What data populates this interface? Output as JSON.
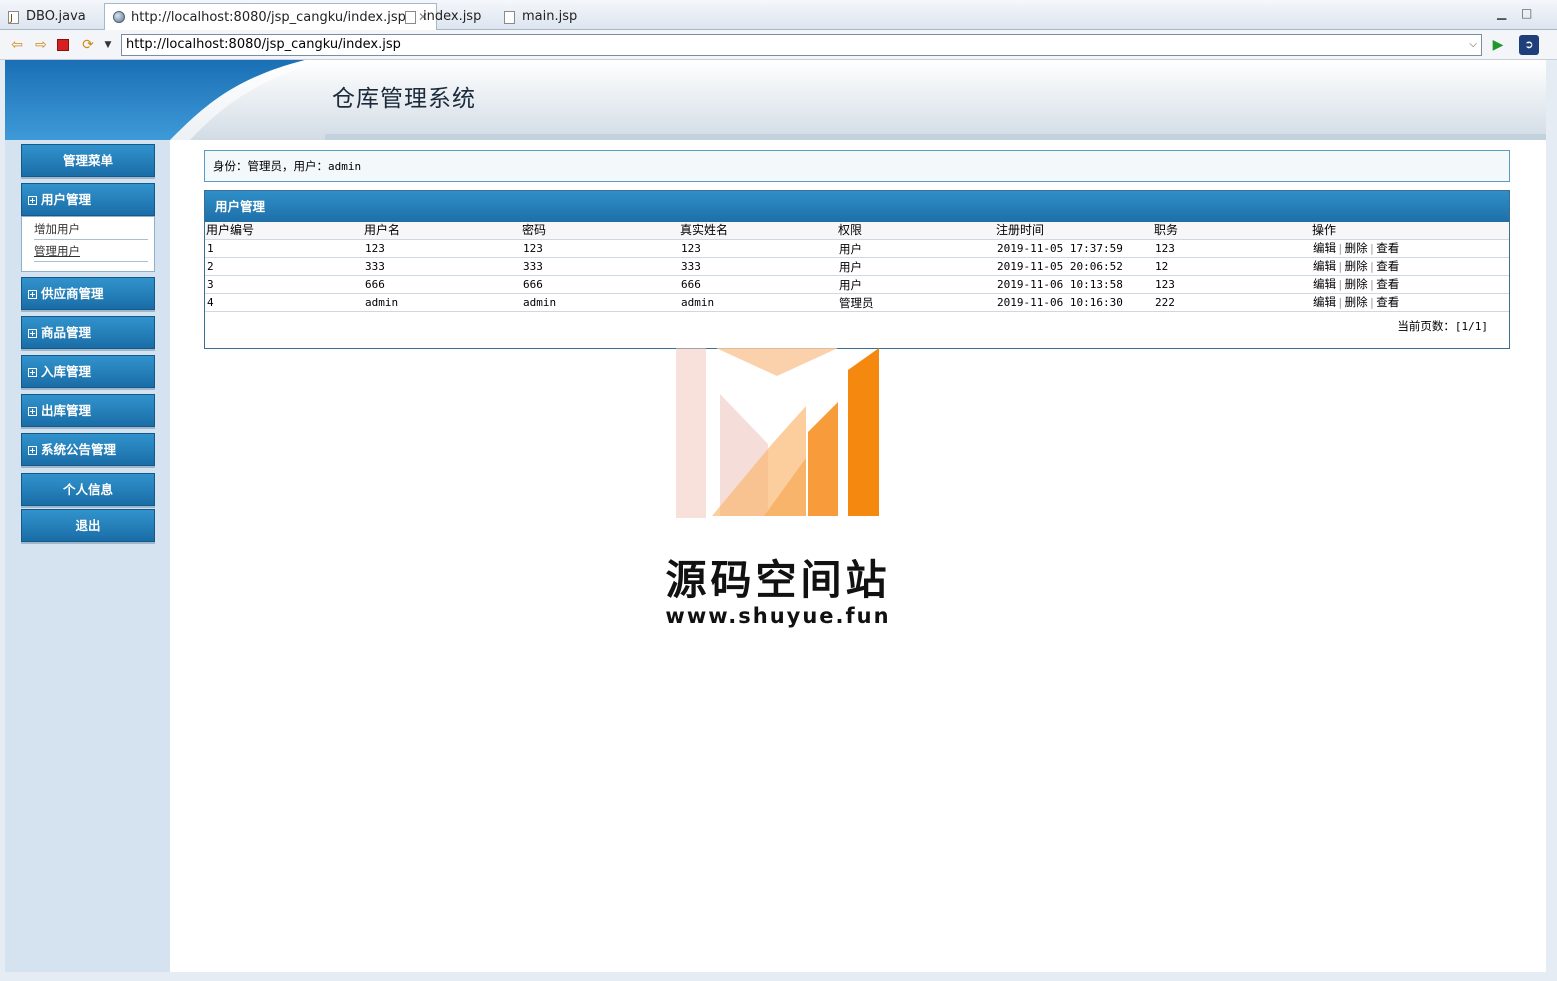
{
  "editor_tabs": [
    {
      "label": "DBO.java"
    },
    {
      "label": "http://localhost:8080/jsp_cangku/index.jsp"
    },
    {
      "label": "index.jsp"
    },
    {
      "label": "main.jsp"
    }
  ],
  "browser": {
    "url": "http://localhost:8080/jsp_cangku/index.jsp"
  },
  "header": {
    "title": "仓库管理系统"
  },
  "sidebar": {
    "menu_title": "管理菜单",
    "user_mgmt": "用户管理",
    "sub_items": [
      "增加用户",
      "管理用户"
    ],
    "supplier_mgmt": "供应商管理",
    "goods_mgmt": "商品管理",
    "inbound_mgmt": "入库管理",
    "outbound_mgmt": "出库管理",
    "notice_mgmt": "系统公告管理",
    "profile": "个人信息",
    "logout": "退出"
  },
  "identity": {
    "label": "身份：管理员，用户：",
    "user": "admin"
  },
  "panel": {
    "title": "用户管理",
    "columns": [
      "用户编号",
      "用户名",
      "密码",
      "真实姓名",
      "权限",
      "注册时间",
      "职务",
      "操作"
    ],
    "rows": [
      {
        "id": "1",
        "username": "123",
        "password": "123",
        "realname": "123",
        "role": "用户",
        "regtime": "2019-11-05 17:37:59",
        "job": "123"
      },
      {
        "id": "2",
        "username": "333",
        "password": "333",
        "realname": "333",
        "role": "用户",
        "regtime": "2019-11-05 20:06:52",
        "job": "12"
      },
      {
        "id": "3",
        "username": "666",
        "password": "666",
        "realname": "666",
        "role": "用户",
        "regtime": "2019-11-06 10:13:58",
        "job": "123"
      },
      {
        "id": "4",
        "username": "admin",
        "password": "admin",
        "realname": "admin",
        "role": "管理员",
        "regtime": "2019-11-06 10:16:30",
        "job": "222"
      }
    ],
    "actions": {
      "edit": "编辑",
      "delete": "删除",
      "view": "查看"
    },
    "pager_label": "当前页数：",
    "pager_value": "[1/1]"
  },
  "watermark": {
    "text": "源码空间站",
    "url": "www.shuyue.fun"
  },
  "colors": {
    "header_blue": "#1a6da7",
    "sidebar_bg": "#d5e3f0",
    "logo_orange": "#f5890f"
  }
}
